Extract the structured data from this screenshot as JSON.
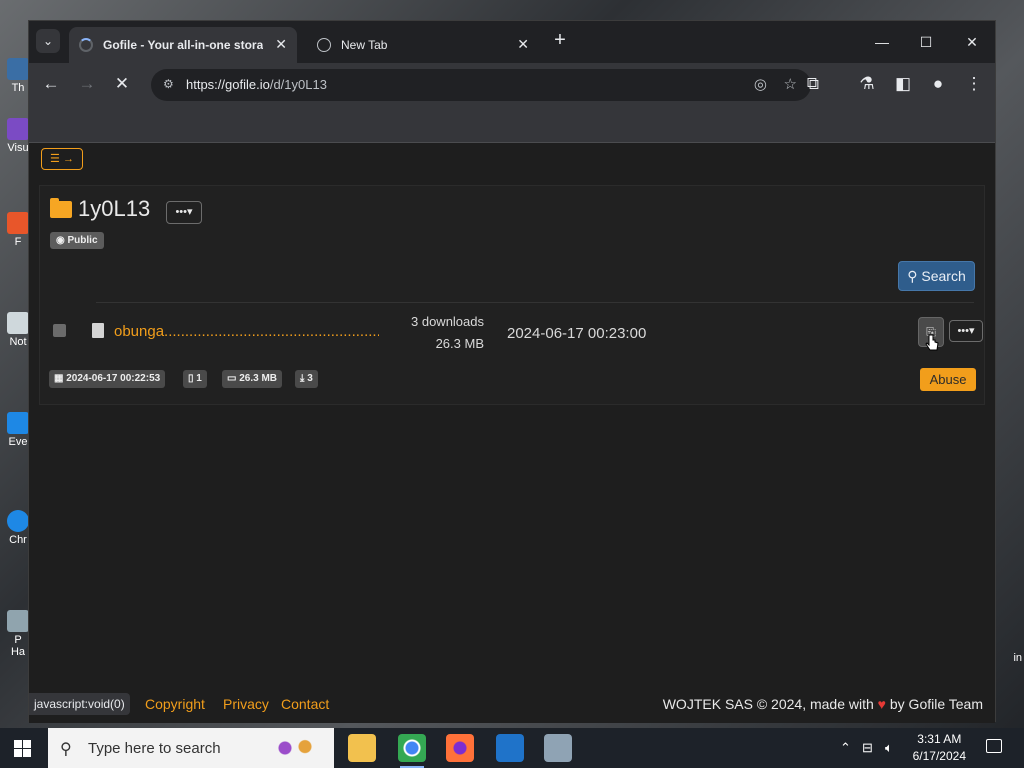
{
  "desktop": {
    "icons": [
      "Th",
      "Visu",
      "F",
      "Not",
      "Eve",
      "Chr",
      "P\nHa"
    ],
    "right_label": "in"
  },
  "browser": {
    "tabs": [
      {
        "title": "Gofile - Your all-in-one storage",
        "active": true
      },
      {
        "title": "New Tab",
        "active": false
      }
    ],
    "new_tab": "+",
    "url_host": "https://gofile.io",
    "url_path": "/d/1y0L13",
    "window_controls": [
      "minimize-icon",
      "maximize-icon",
      "close-icon"
    ]
  },
  "page": {
    "folder_name": "1y0L13",
    "public_badge": "Public",
    "search_label": "Search",
    "file": {
      "name": "obunga..........................................................",
      "downloads": "3 downloads",
      "size": "26.3 MB",
      "date": "2024-06-17 00:23:00"
    },
    "meta": {
      "created": "2024-06-17 00:22:53",
      "count": "1",
      "total_size": "26.3 MB",
      "total_downloads": "3"
    },
    "abuse_label": "Abuse"
  },
  "footer": {
    "status_url": "javascript:void(0)",
    "links": [
      "Copyright",
      "Privacy",
      "Contact"
    ],
    "copyright_prefix": "WOJTEK SAS © 2024, made with",
    "copyright_suffix": "by Gofile Team"
  },
  "taskbar": {
    "search_placeholder": "Type here to search",
    "time": "3:31 AM",
    "date": "6/17/2024"
  },
  "colors": {
    "accent": "#f29e1b",
    "search_button": "#2f5d8c",
    "page_bg": "#1e1e1e"
  }
}
